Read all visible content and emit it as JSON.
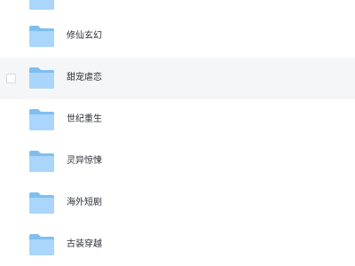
{
  "folders": [
    {
      "name": ""
    },
    {
      "name": "修仙玄幻"
    },
    {
      "name": "甜宠虐恋"
    },
    {
      "name": "世纪重生"
    },
    {
      "name": "灵异惊悚"
    },
    {
      "name": "海外短剧"
    },
    {
      "name": "古装穿越"
    }
  ],
  "colors": {
    "folder_back": "#7fbef0",
    "folder_front": "#a9d6fa",
    "hover_row": "#f5f6f7"
  },
  "icons": {
    "folder": "folder-icon",
    "checkbox": "checkbox"
  }
}
